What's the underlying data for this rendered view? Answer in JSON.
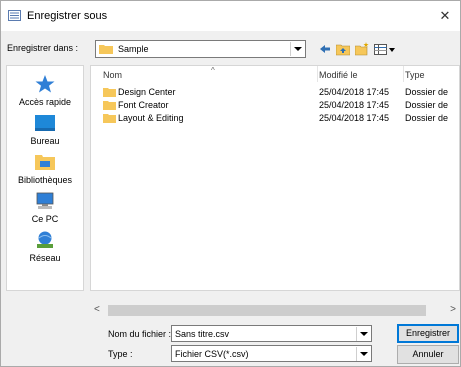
{
  "window": {
    "title": "Enregistrer sous",
    "close_label": "✕"
  },
  "toolbar": {
    "lookin_label": "Enregistrer dans :",
    "lookin_value": "Sample"
  },
  "places": [
    {
      "label": "Accès rapide",
      "icon": "star-icon"
    },
    {
      "label": "Bureau",
      "icon": "desktop-icon"
    },
    {
      "label": "Bibliothèques",
      "icon": "libraries-icon"
    },
    {
      "label": "Ce PC",
      "icon": "computer-icon"
    },
    {
      "label": "Réseau",
      "icon": "network-icon"
    }
  ],
  "filelist": {
    "columns": [
      "Nom",
      "Modifié le",
      "Type"
    ],
    "rows": [
      {
        "name": "Design Center",
        "date": "25/04/2018 17:45",
        "type": "Dossier de"
      },
      {
        "name": "Font Creator",
        "date": "25/04/2018 17:45",
        "type": "Dossier de"
      },
      {
        "name": "Layout & Editing",
        "date": "25/04/2018 17:45",
        "type": "Dossier de"
      }
    ]
  },
  "form": {
    "filename_label": "Nom du fichier :",
    "filename_value": "Sans titre.csv",
    "type_label": "Type :",
    "type_value": "Fichier CSV(*.csv)"
  },
  "buttons": {
    "save": "Enregistrer",
    "cancel": "Annuler"
  },
  "colors": {
    "folder": "#f6c75a",
    "accent": "#0078d7"
  }
}
